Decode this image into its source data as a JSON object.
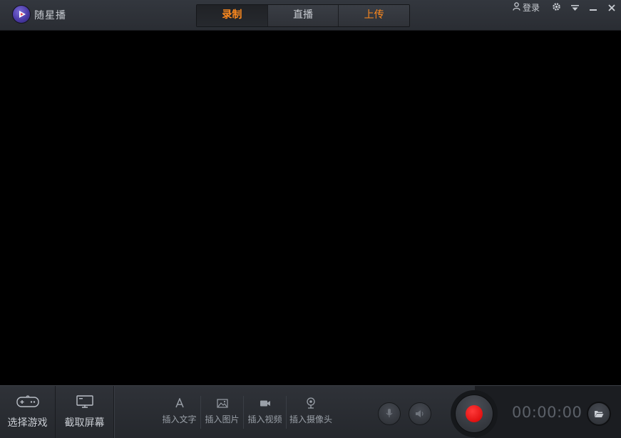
{
  "app": {
    "title": "随星播"
  },
  "tabs": [
    {
      "label": "录制",
      "active": true
    },
    {
      "label": "直播",
      "active": false
    },
    {
      "label": "上传",
      "active": false
    }
  ],
  "top_controls": {
    "login_label": "登录",
    "icons": [
      "user-icon",
      "gear-icon",
      "dropdown-icon",
      "minimize-icon",
      "close-icon"
    ]
  },
  "bottom": {
    "select_game_label": "选择游戏",
    "capture_screen_label": "截取屏幕",
    "insert_items": [
      {
        "label": "插入文字",
        "icon": "text-icon"
      },
      {
        "label": "插入图片",
        "icon": "image-icon"
      },
      {
        "label": "插入视频",
        "icon": "video-icon"
      },
      {
        "label": "插入摄像头",
        "icon": "webcam-icon"
      }
    ],
    "timer": "00:00:00"
  },
  "colors": {
    "accent": "#ff8a1e",
    "record": "#e60000",
    "titlebar": "#30343a",
    "text": "#c9cdd3"
  }
}
